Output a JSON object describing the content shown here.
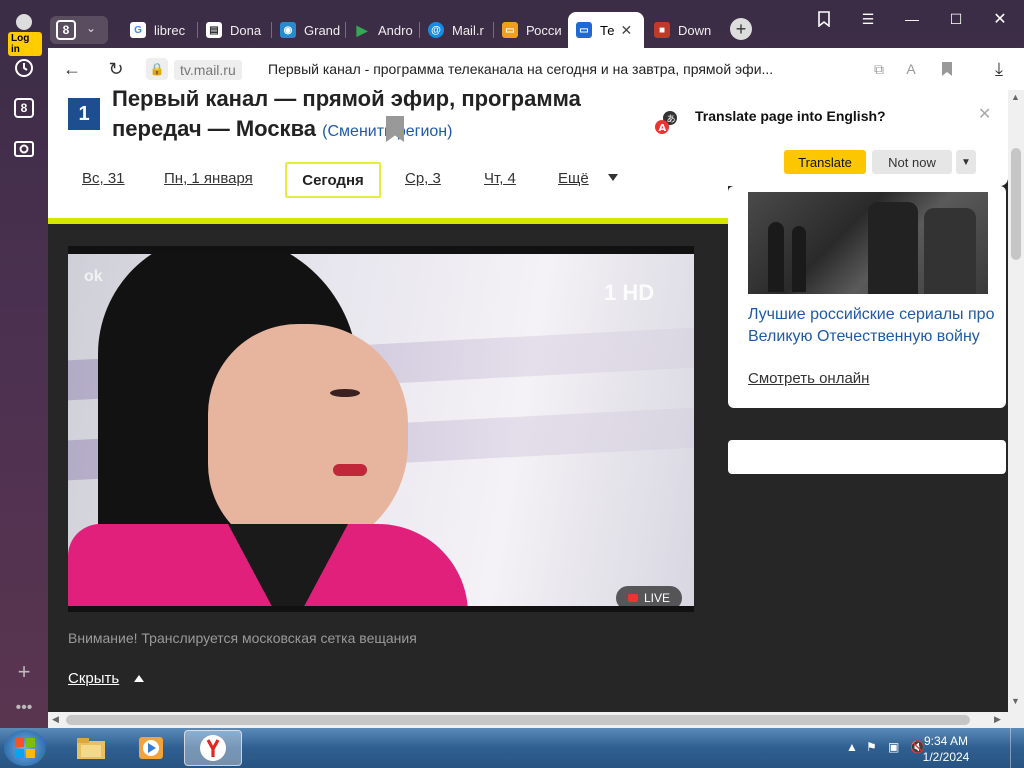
{
  "browser": {
    "login_label": "Log in",
    "tab_count": "8",
    "tabs": [
      {
        "label": "librec",
        "icon": "google-icon",
        "color": "#ffffff"
      },
      {
        "label": "Dona",
        "icon": "document-icon",
        "color": "#ffffff"
      },
      {
        "label": "Grand",
        "icon": "globe-icon",
        "color": "#2a8ad0"
      },
      {
        "label": "Andro",
        "icon": "play-icon",
        "color": "#34a853"
      },
      {
        "label": "Mail.r",
        "icon": "at-icon",
        "color": "#168de2"
      },
      {
        "label": "Росси",
        "icon": "monitor-icon",
        "color": "#f0a020"
      },
      {
        "label": "Те",
        "icon": "monitor-icon",
        "color": "#1e6ad0",
        "active": true
      },
      {
        "label": "Down",
        "icon": "app-icon",
        "color": "#c0392b"
      }
    ],
    "address": {
      "domain": "tv.mail.ru",
      "title": "Первый канал - программа телеканала на сегодня и на завтра, прямой эфи..."
    }
  },
  "page": {
    "heading": "Первый канал — прямой эфир, программа передач — Москва",
    "region_link": "(Сменить регион)",
    "day_tabs": [
      "Вс, 31",
      "Пн, 1 января",
      "Сегодня",
      "Ср, 3",
      "Чт, 4",
      "Ещё"
    ],
    "selected_day": "Сегодня",
    "video": {
      "channel_watermark": "1 HD",
      "corner_logo": "ok",
      "live_label": "LIVE"
    },
    "notice": "Внимание! Транслируется московская сетка вещания",
    "hide_label": "Скрыть"
  },
  "sidebar_card": {
    "title": "Лучшие российские сериалы про Великую Отечественную войну",
    "link": "Смотреть онлайн"
  },
  "translate_popup": {
    "question": "Translate page into English?",
    "translate_label": "Translate",
    "not_now_label": "Not now"
  },
  "taskbar": {
    "time": "9:34 AM",
    "date": "1/2/2024"
  },
  "colors": {
    "accent_yellow": "#fcc600",
    "link_blue": "#1e5aa8",
    "selected_day_border": "#e8ec3a"
  }
}
